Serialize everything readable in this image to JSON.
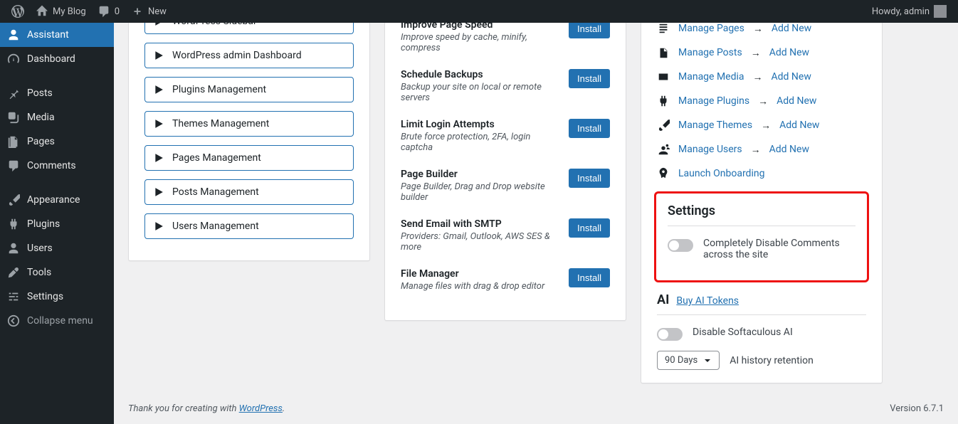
{
  "adminbar": {
    "site_name": "My Blog",
    "comments_count": "0",
    "new_label": "New",
    "howdy": "Howdy, admin"
  },
  "sidebar": {
    "items": [
      {
        "id": "assistant",
        "label": "Assistant",
        "current": true
      },
      {
        "id": "dashboard",
        "label": "Dashboard"
      },
      {
        "id": "posts",
        "label": "Posts"
      },
      {
        "id": "media",
        "label": "Media"
      },
      {
        "id": "pages",
        "label": "Pages"
      },
      {
        "id": "comments",
        "label": "Comments"
      },
      {
        "id": "appearance",
        "label": "Appearance"
      },
      {
        "id": "plugins",
        "label": "Plugins"
      },
      {
        "id": "users",
        "label": "Users"
      },
      {
        "id": "tools",
        "label": "Tools"
      },
      {
        "id": "settings",
        "label": "Settings"
      },
      {
        "id": "collapse",
        "label": "Collapse menu"
      }
    ]
  },
  "actions": [
    "WordPress Sidebar",
    "WordPress admin Dashboard",
    "Plugins Management",
    "Themes Management",
    "Pages Management",
    "Posts Management",
    "Users Management"
  ],
  "features": [
    {
      "title": "Improve Page Speed",
      "desc": "Improve speed by cache, minify, compress"
    },
    {
      "title": "Schedule Backups",
      "desc": "Backup your site on local or remote servers"
    },
    {
      "title": "Limit Login Attempts",
      "desc": "Brute force protection, 2FA, login captcha"
    },
    {
      "title": "Page Builder",
      "desc": "Page Builder, Drag and Drop website builder"
    },
    {
      "title": "Send Email with SMTP",
      "desc": "Providers: Gmail, Outlook, AWS SES & more"
    },
    {
      "title": "File Manager",
      "desc": "Manage files with drag & drop editor"
    }
  ],
  "install_label": "Install",
  "quick_links": [
    {
      "label": "Manage Pages",
      "add": "Add New"
    },
    {
      "label": "Manage Posts",
      "add": "Add New"
    },
    {
      "label": "Manage Media",
      "add": "Add New"
    },
    {
      "label": "Manage Plugins",
      "add": "Add New"
    },
    {
      "label": "Manage Themes",
      "add": "Add New"
    },
    {
      "label": "Manage Users",
      "add": "Add New"
    }
  ],
  "launch_onboarding": "Launch Onboarding",
  "settings": {
    "title": "Settings",
    "disable_comments": "Completely Disable Comments across the site"
  },
  "ai": {
    "title": "AI",
    "buy_tokens": "Buy AI Tokens",
    "disable_ai": "Disable Softaculous AI",
    "history_select": "90 Days",
    "history_label": "AI history retention"
  },
  "footer": {
    "thanks_pre": "Thank you for creating with ",
    "wp_link": "WordPress",
    "thanks_post": ".",
    "version": "Version 6.7.1"
  }
}
